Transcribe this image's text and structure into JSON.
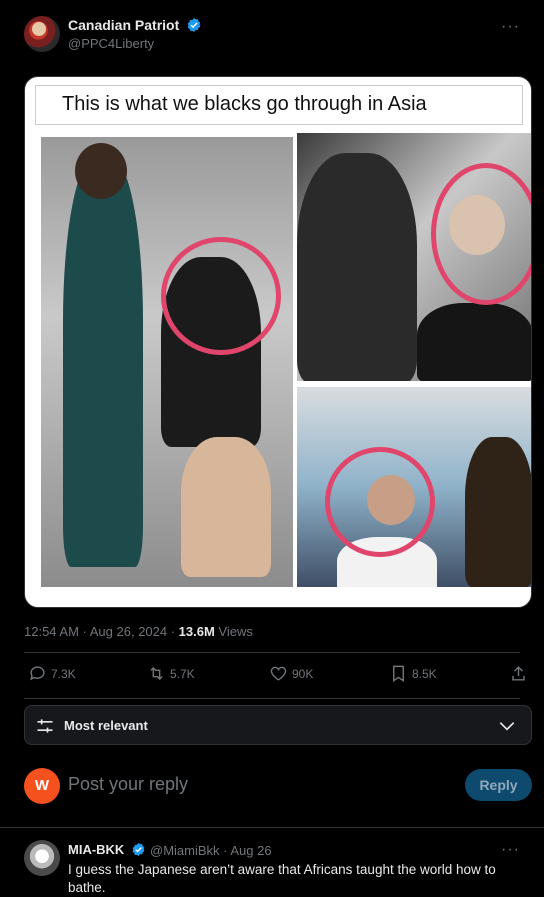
{
  "post": {
    "author_name": "Canadian Patriot",
    "author_handle": "@PPC4Liberty",
    "more_label": "···",
    "image_caption": "This is what we blacks go through in Asia",
    "timestamp": "12:54 AM · Aug 26, 2024 · ",
    "views_count": "13.6M",
    "views_label": " Views"
  },
  "actions": {
    "replies": "7.3K",
    "reposts": "5.7K",
    "likes": "90K",
    "bookmarks": "8.5K"
  },
  "sort": {
    "label": "Most relevant"
  },
  "compose": {
    "avatar_letter": "W",
    "placeholder": "Post your reply",
    "reply_button": "Reply"
  },
  "comment": {
    "name": "MIA-BKK",
    "handle_date": "@MiamiBkk · Aug 26",
    "more_label": "···",
    "text": "I guess the Japanese aren’t aware that Africans taught the world how to bathe."
  },
  "colors": {
    "background": "#000000",
    "verified": "#1d9bf0",
    "reply_button": "#0e4a6e",
    "compose_avatar": "#f4511e"
  }
}
